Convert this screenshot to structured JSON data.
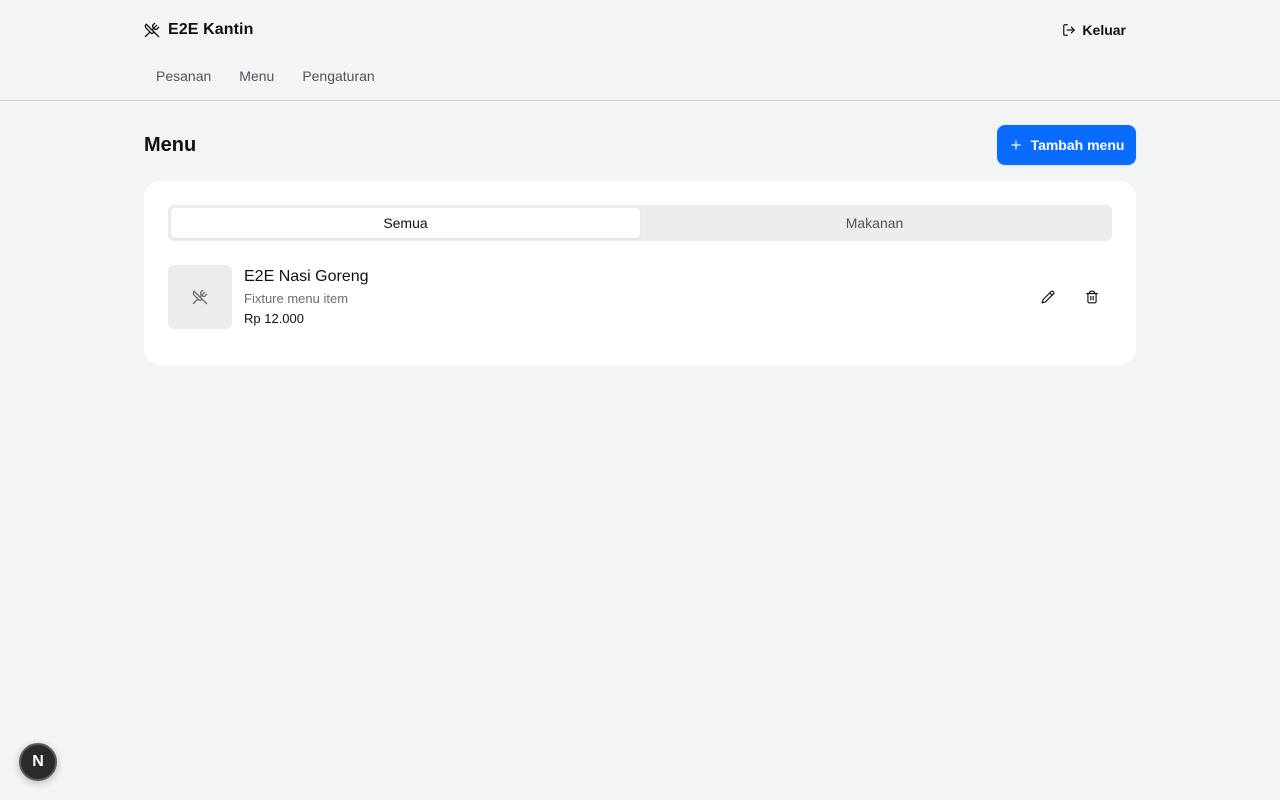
{
  "header": {
    "brand_name": "E2E Kantin",
    "brand_icon": "utensils-crossed-icon",
    "logout_label": "Keluar",
    "logout_icon": "log-out-icon"
  },
  "nav": {
    "items": [
      {
        "label": "Pesanan"
      },
      {
        "label": "Menu"
      },
      {
        "label": "Pengaturan"
      }
    ]
  },
  "main": {
    "title": "Menu",
    "add_button_label": "Tambah menu",
    "add_icon": "plus-icon",
    "accent_color": "#0a6cff"
  },
  "tabs": [
    {
      "label": "Semua",
      "active": true
    },
    {
      "label": "Makanan",
      "active": false
    }
  ],
  "menu_items": [
    {
      "name": "E2E Nasi Goreng",
      "description": "Fixture menu item",
      "price": "Rp 12.000",
      "thumbnail_icon": "utensils-crossed-icon",
      "edit_icon": "pencil-icon",
      "delete_icon": "trash-icon"
    }
  ],
  "dev_badge": {
    "label": "N",
    "icon": "nextjs-logo-icon"
  }
}
